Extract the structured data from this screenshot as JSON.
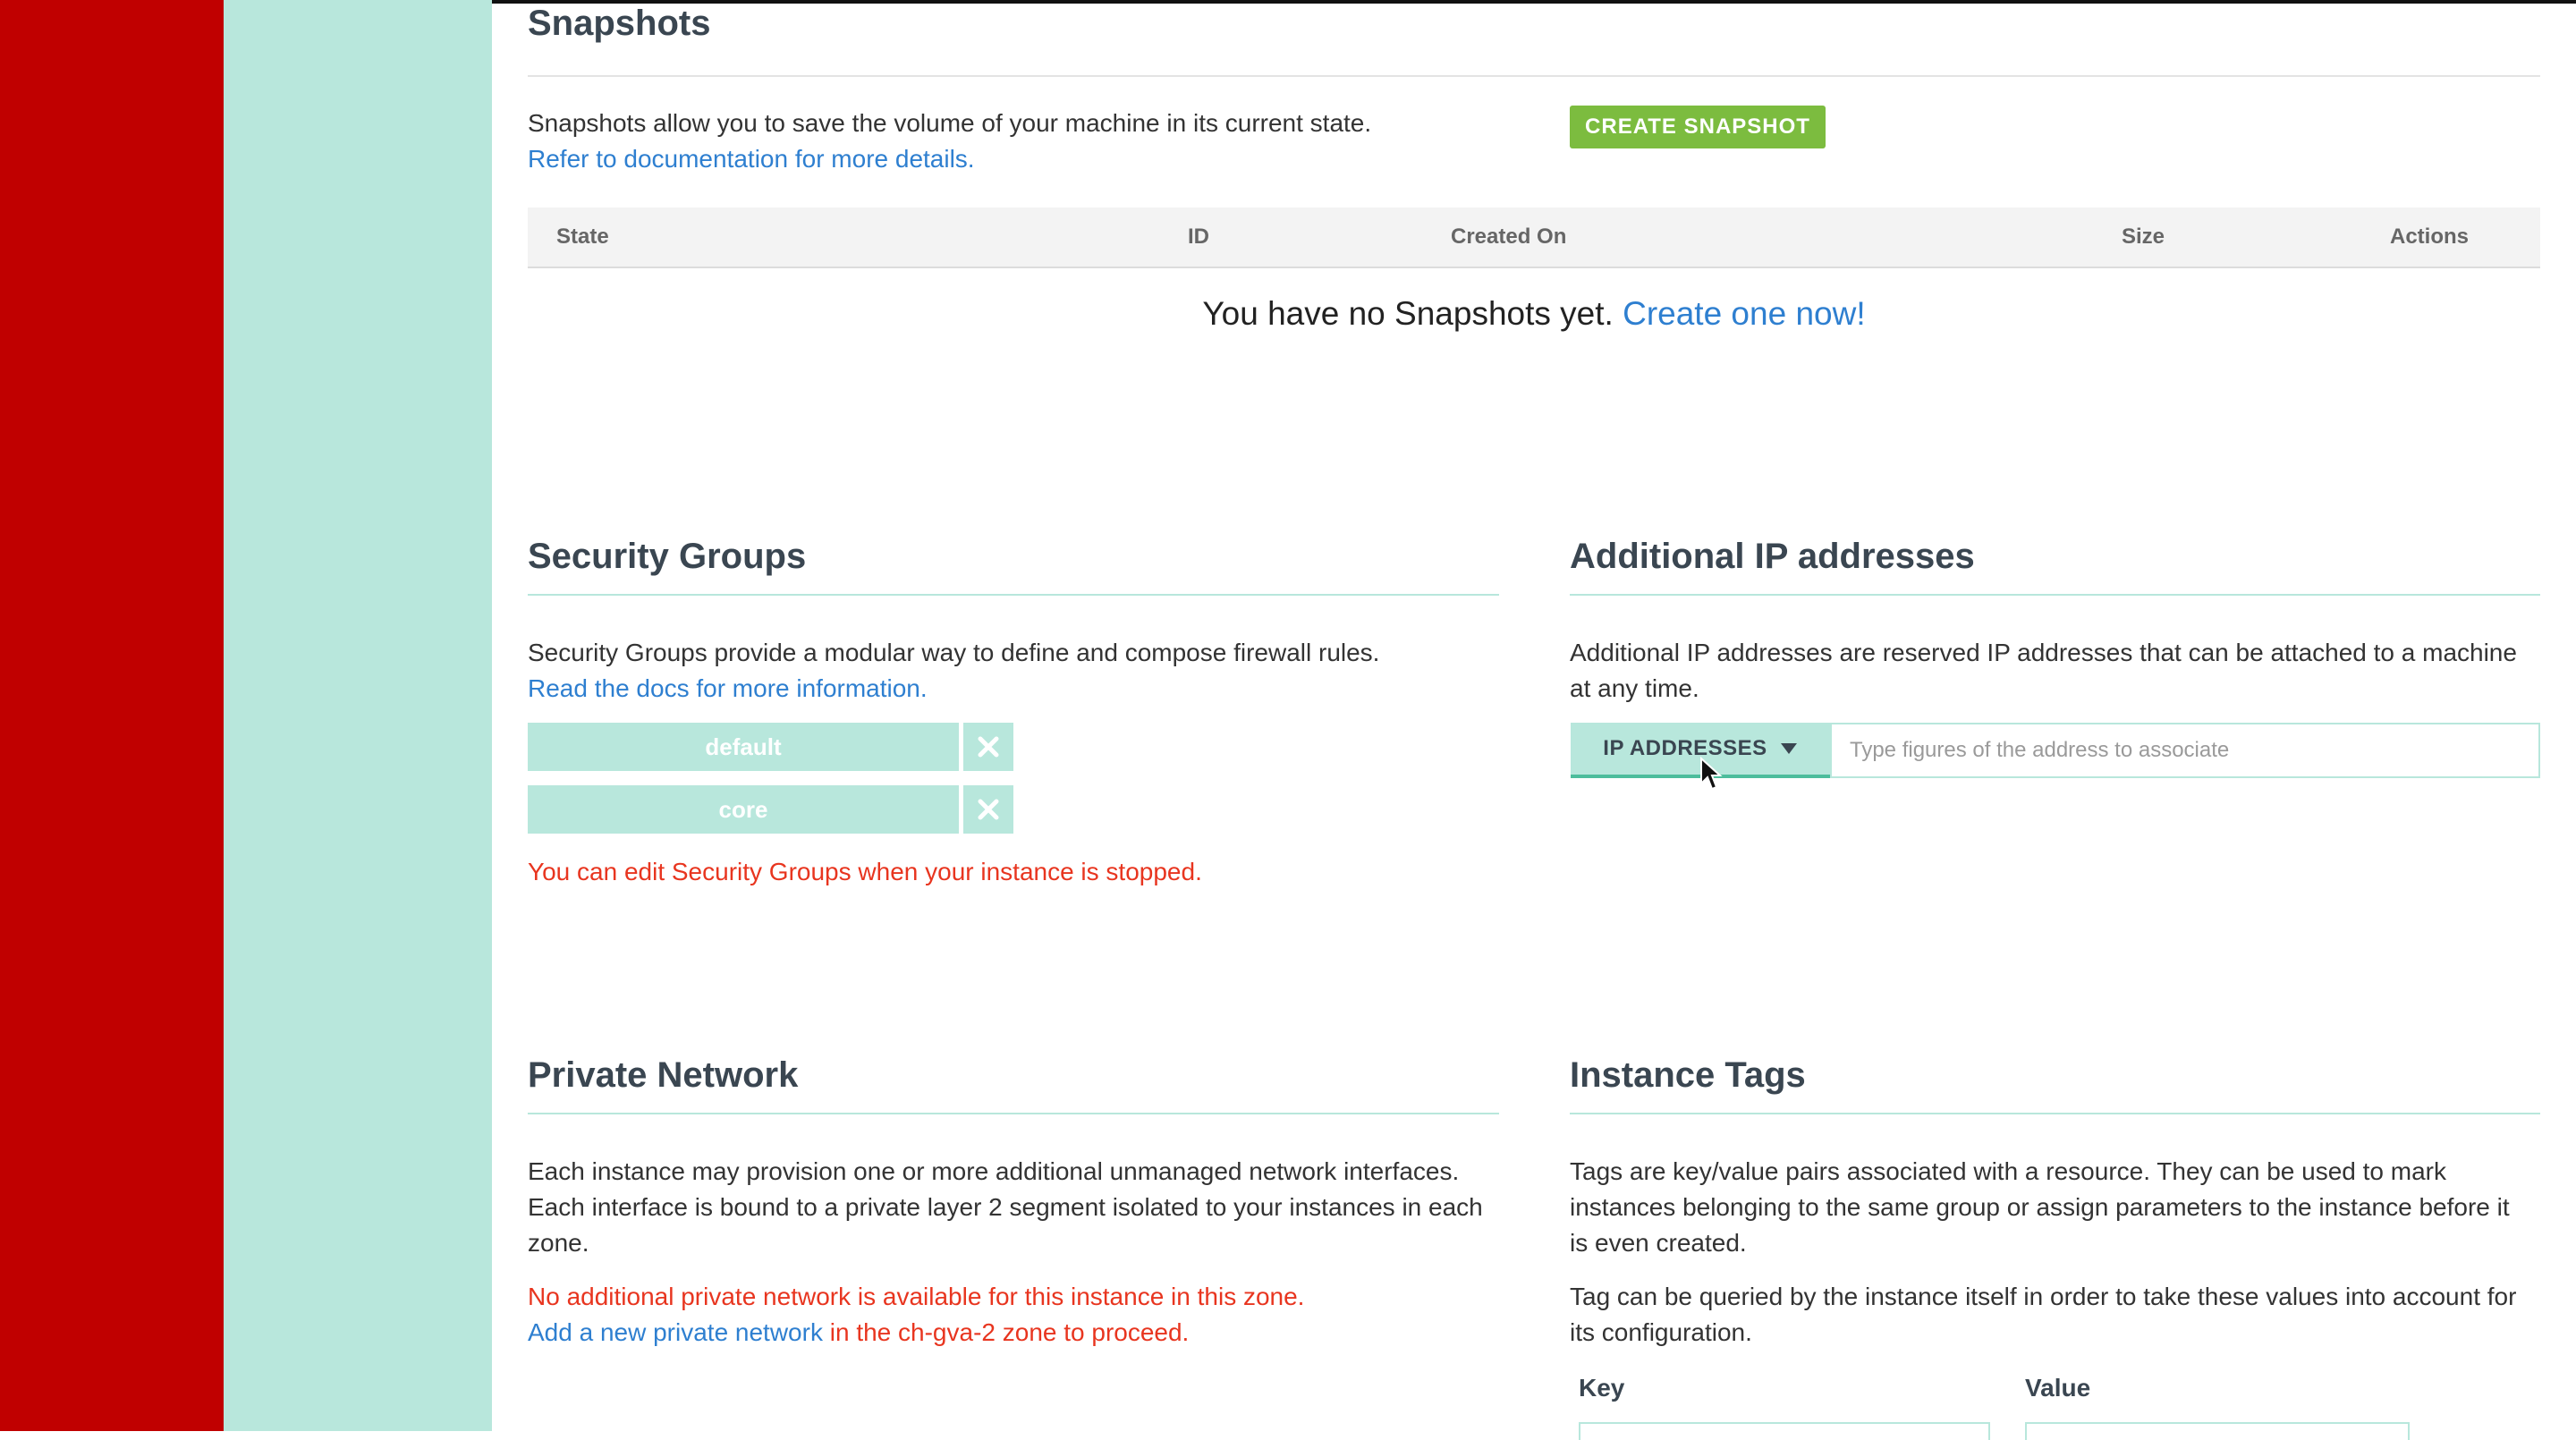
{
  "snapshots": {
    "title": "Snapshots",
    "description": "Snapshots allow you to save the volume of your machine in its current state.",
    "doc_link": "Refer to documentation for more details.",
    "create_button": "CREATE SNAPSHOT",
    "columns": [
      "State",
      "ID",
      "Created On",
      "Size",
      "Actions"
    ],
    "empty_text": "You have no Snapshots yet.",
    "empty_link": "Create one now!"
  },
  "security_groups": {
    "title": "Security Groups",
    "description": "Security Groups provide a modular way to define and compose firewall rules.",
    "doc_link": "Read the docs for more information.",
    "groups": [
      "default",
      "core"
    ],
    "warning": "You can edit Security Groups when your instance is stopped."
  },
  "additional_ip": {
    "title": "Additional IP addresses",
    "description_line1": "Additional IP addresses are reserved IP addresses that can be attached to a machine",
    "description_line2": "at any time.",
    "dropdown_label": "IP ADDRESSES",
    "input_placeholder": "Type figures of the address to associate"
  },
  "private_network": {
    "title": "Private Network",
    "description_line1": "Each instance may provision one or more additional unmanaged network interfaces.",
    "description_line2": "Each interface is bound to a private layer 2 segment isolated to your instances in each",
    "description_line3": "zone.",
    "warning": "No additional private network is available for this instance in this zone.",
    "add_link": "Add a new private network",
    "add_suffix": " in the ch-gva-2 zone to proceed."
  },
  "instance_tags": {
    "title": "Instance Tags",
    "description_line1": "Tags are key/value pairs associated with a resource. They can be used to mark",
    "description_line2": "instances belonging to the same group or assign parameters to the instance before it",
    "description_line3": "is even created.",
    "note_line1": "Tag can be queried by the instance itself in order to take these values into account for",
    "note_line2": "its configuration.",
    "key_label": "Key",
    "value_label": "Value"
  },
  "colors": {
    "sidebar_red": "#c00000",
    "sidebar_mint": "#b8e7dc",
    "accent_green": "#7cbc3f",
    "link_blue": "#2e7fd0",
    "warning_red": "#e8351f"
  }
}
